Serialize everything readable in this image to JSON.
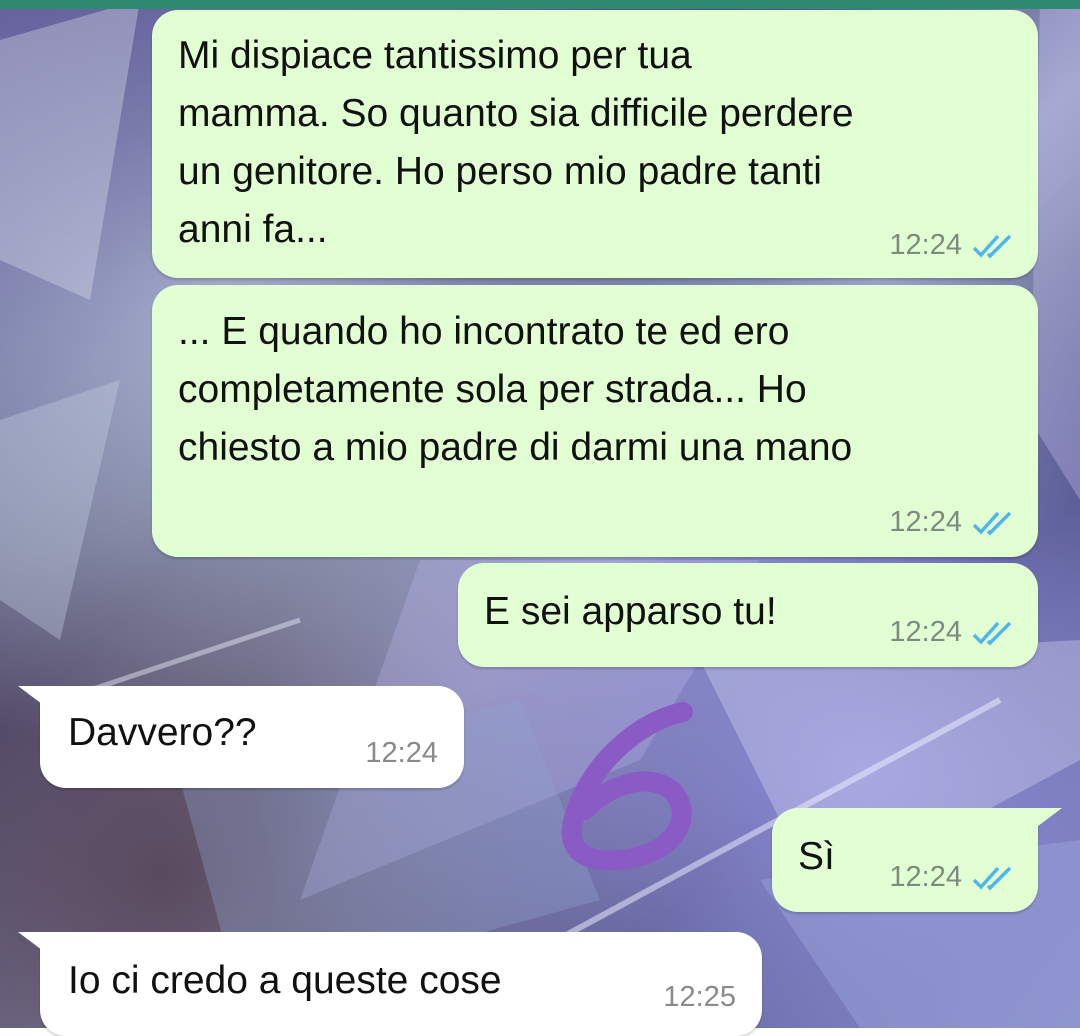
{
  "messages": [
    {
      "direction": "outgoing",
      "text": "Mi dispiace tantissimo per tua\nmamma. So quanto sia difficile perdere\nun genitore. Ho perso mio padre tanti\nanni fa...",
      "time": "12:24",
      "status": "read"
    },
    {
      "direction": "outgoing",
      "text": "... E quando ho incontrato te ed ero\ncompletamente sola per strada... Ho\nchiesto a mio padre di darmi una mano",
      "time": "12:24",
      "status": "read"
    },
    {
      "direction": "outgoing",
      "text": "E sei apparso tu!",
      "time": "12:24",
      "status": "read"
    },
    {
      "direction": "incoming",
      "text": "Davvero??",
      "time": "12:24"
    },
    {
      "direction": "outgoing",
      "text": "Sì",
      "time": "12:24",
      "status": "read"
    },
    {
      "direction": "incoming",
      "text": "Io ci credo a queste cose",
      "time": "12:25"
    }
  ],
  "annotation": {
    "text": "6",
    "color": "#8a5bc4"
  },
  "colors": {
    "outgoing_bubble": "#e2ffd4",
    "incoming_bubble": "#ffffff",
    "read_ticks": "#4fb6ec",
    "header": "#2e8b72"
  }
}
